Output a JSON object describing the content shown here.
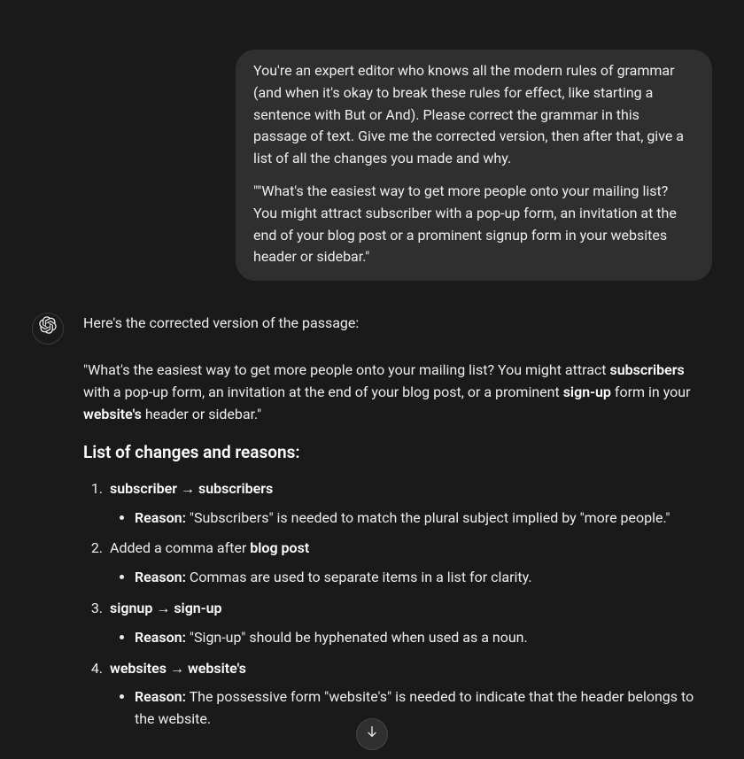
{
  "user": {
    "p1": "You're an expert editor who knows all the modern rules of grammar (and when it's okay to break these rules for effect, like starting a sentence with But or And). Please correct the grammar in this passage of text. Give me the corrected version, then after that, give a list of all the changes you made and why.",
    "p2": "\"\"What's the easiest way to get more people onto your mailing list? You might attract subscriber with a pop-up form, an invitation at the end of your blog post or a prominent signup form in your websites header or sidebar.\""
  },
  "assistant": {
    "lead": "Here's the corrected version of the passage:",
    "corrected": {
      "t1": "\"What's the easiest way to get more people onto your mailing list? You might attract ",
      "b1": "subscribers",
      "t2": " with a pop-up form, an invitation at the end of your blog post, or a prominent ",
      "b2": "sign-up",
      "t3": " form in your ",
      "b3": "website's",
      "t4": " header or sidebar.\""
    },
    "changes_heading": "List of changes and reasons:",
    "reason_label": "Reason:",
    "changes": [
      {
        "title_pre": "subscriber → ",
        "title_bold": "subscribers",
        "reason": " \"Subscribers\" is needed to match the plural subject implied by \"more people.\""
      },
      {
        "title_pre": "Added a comma after ",
        "title_bold": "blog post",
        "reason": " Commas are used to separate items in a list for clarity."
      },
      {
        "title_pre": "signup → ",
        "title_bold": "sign-up",
        "reason": " \"Sign-up\" should be hyphenated when used as a noun."
      },
      {
        "title_pre": "websites → ",
        "title_bold": "website's",
        "reason": " The possessive form \"website's\" is needed to indicate that the header belongs to the website."
      }
    ]
  }
}
